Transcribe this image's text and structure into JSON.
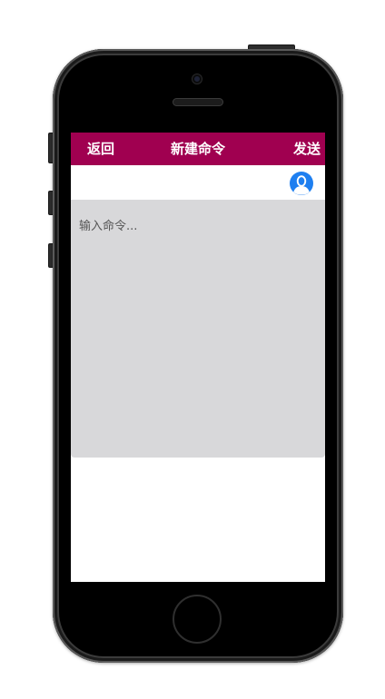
{
  "navbar": {
    "back_label": "返回",
    "title": "新建命令",
    "send_label": "发送"
  },
  "contact": {
    "icon": "user-icon",
    "icon_color": "#1e7ff0"
  },
  "command": {
    "value": "",
    "placeholder": "输入命令..."
  },
  "colors": {
    "navbar_bg": "#a00050",
    "input_area_bg": "#d8d8da"
  }
}
